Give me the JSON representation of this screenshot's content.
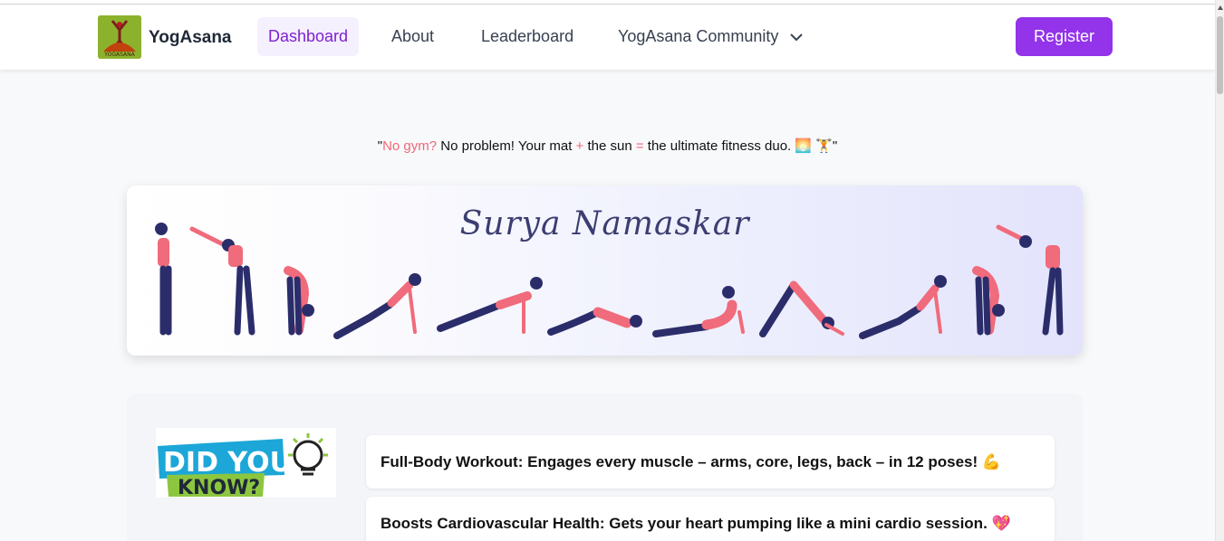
{
  "navbar": {
    "logo_text": "YOGASANA",
    "brand": "YogAsana",
    "items": [
      {
        "label": "Dashboard",
        "active": true
      },
      {
        "label": "About",
        "active": false
      },
      {
        "label": "Leaderboard",
        "active": false
      },
      {
        "label": "YogAsana Community",
        "active": false,
        "dropdown": true
      }
    ],
    "register_label": "Register"
  },
  "quote": {
    "open": "\"",
    "highlight": "No gym?",
    "part1": " No problem! Your mat ",
    "plus": "+",
    "part2": " the sun ",
    "equals": "=",
    "part3": " the ultimate fitness duo. ",
    "emoji": "🌅 🏋",
    "close": "\""
  },
  "banner": {
    "title": "Surya Namaskar",
    "pose_count": 12
  },
  "did_you_know": {
    "line1": "DID YOU",
    "line2": "KNOW?"
  },
  "facts": [
    {
      "text": "Full-Body Workout: Engages every muscle – arms, core, legs, back – in 12 poses! 💪"
    },
    {
      "text": "Boosts Cardiovascular Health: Gets your heart pumping like a mini cardio session. 💖"
    }
  ],
  "colors": {
    "accent": "#9333ea",
    "active_text": "#7e22ce",
    "active_bg": "#f5f0fe",
    "pink": "#f0677a",
    "figure_top": "#f06b7b",
    "figure_pants": "#2b2d6b"
  }
}
